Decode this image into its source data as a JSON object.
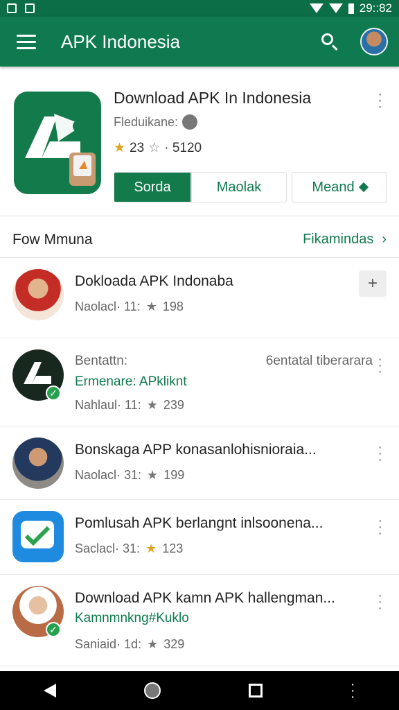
{
  "status_bar": {
    "time": "29::82"
  },
  "app_bar": {
    "title": "APK Indonesia"
  },
  "hero": {
    "app_name": "Download APK In Indonesia",
    "subtitle": "Fleduikane:",
    "rating": "23",
    "review_meta": "· 5120",
    "buttons": [
      "Sorda",
      "Maolak",
      "Meand"
    ]
  },
  "section": {
    "title": "Fow Mmuna",
    "link": "Fikamindas"
  },
  "list": [
    {
      "title": "Dokloada APK Indonaba",
      "meta_left": "Naolacl· 11:",
      "meta_rating": "198"
    },
    {
      "title": "Bentattn:",
      "title_right": "6entatal tiberarara",
      "subtitle": "Ermenare: APkliknt",
      "meta_left": "Nahlaul· 11:",
      "meta_rating": "239"
    },
    {
      "title": "Bonskaga APP konasanlohisnioraia...",
      "meta_left": "Naolacl· 31:",
      "meta_rating": "199"
    },
    {
      "title": "Pomlusah APK berlangnt inlsoonena...",
      "meta_left": "Saclacl· 31:",
      "meta_rating": "123"
    },
    {
      "title": "Download APK kamn APK hallengman...",
      "subtitle": "Kamnmnkng#Kuklo",
      "meta_left": "Saniaid· 1d:",
      "meta_rating": "329"
    }
  ],
  "colors": {
    "primary": "#0f7a4f",
    "star": "#e0a51b"
  }
}
